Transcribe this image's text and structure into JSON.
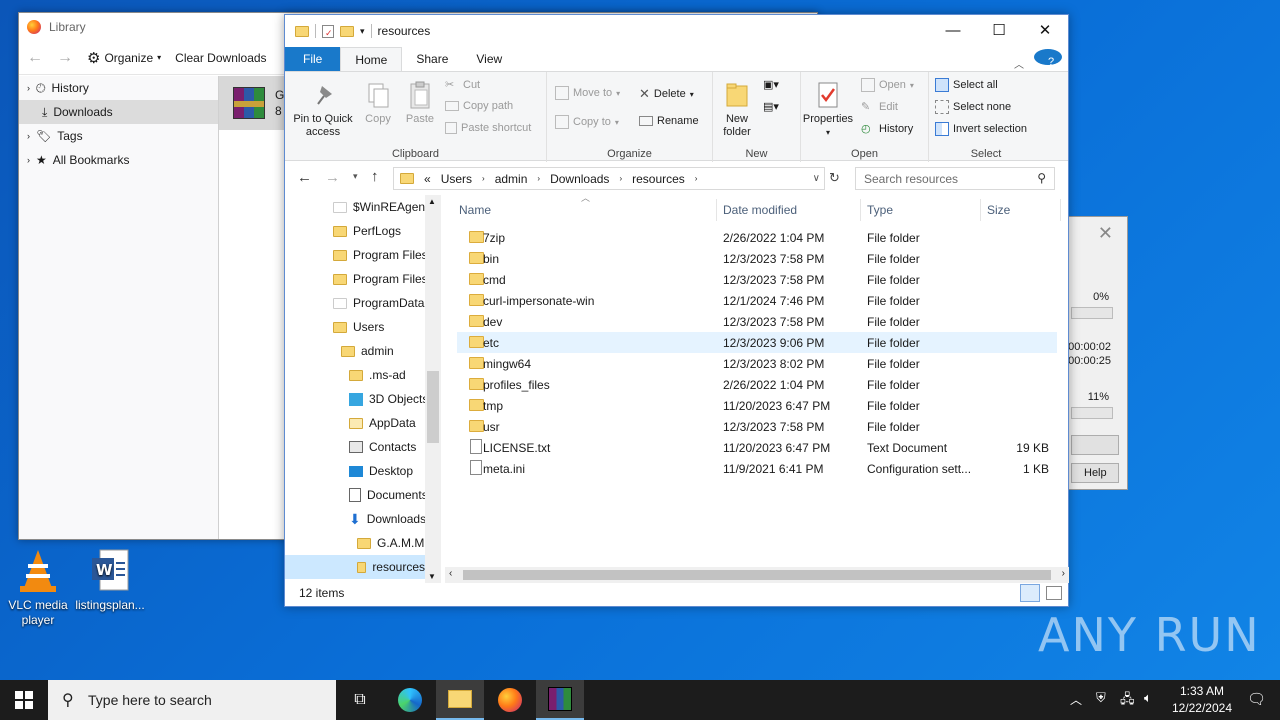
{
  "desktop": {
    "icons": [
      {
        "label": "VLC media player"
      },
      {
        "label": "listingsplan..."
      }
    ],
    "watermark": "ANY RUN"
  },
  "library": {
    "title": "Library",
    "organize_label": "Organize",
    "clear_downloads_label": "Clear Downloads",
    "sidebar": [
      {
        "label": "History"
      },
      {
        "label": "Downloads"
      },
      {
        "label": "Tags"
      },
      {
        "label": "All Bookmarks"
      }
    ],
    "download_item_prefix": "G",
    "download_item_sub": "8"
  },
  "dialog": {
    "pct1": "0%",
    "time1": "00:00:02",
    "time2": "00:00:25",
    "pct2": "11%",
    "help_label": "Help"
  },
  "explorer": {
    "title": "resources",
    "tabs": {
      "file": "File",
      "home": "Home",
      "share": "Share",
      "view": "View"
    },
    "ribbon": {
      "pin_quick_access": "Pin to Quick access",
      "copy": "Copy",
      "paste": "Paste",
      "cut": "Cut",
      "copy_path": "Copy path",
      "paste_shortcut": "Paste shortcut",
      "clipboard_group": "Clipboard",
      "move_to": "Move to",
      "copy_to": "Copy to",
      "delete": "Delete",
      "rename": "Rename",
      "organize_group": "Organize",
      "new_folder": "New folder",
      "new_group": "New",
      "properties": "Properties",
      "open": "Open",
      "edit": "Edit",
      "history": "History",
      "open_group": "Open",
      "select_all": "Select all",
      "select_none": "Select none",
      "invert_selection": "Invert selection",
      "select_group": "Select"
    },
    "breadcrumb": [
      "«",
      "Users",
      "admin",
      "Downloads",
      "resources"
    ],
    "search_placeholder": "Search resources",
    "nav_tree": [
      {
        "label": "$WinREAgent"
      },
      {
        "label": "PerfLogs"
      },
      {
        "label": "Program Files"
      },
      {
        "label": "Program Files"
      },
      {
        "label": "ProgramData"
      },
      {
        "label": "Users"
      },
      {
        "label": "admin"
      },
      {
        "label": ".ms-ad"
      },
      {
        "label": "3D Objects"
      },
      {
        "label": "AppData"
      },
      {
        "label": "Contacts"
      },
      {
        "label": "Desktop"
      },
      {
        "label": "Documents"
      },
      {
        "label": "Downloads"
      },
      {
        "label": "G.A.M.M"
      },
      {
        "label": "resources"
      }
    ],
    "columns": {
      "name": "Name",
      "date": "Date modified",
      "type": "Type",
      "size": "Size"
    },
    "files": [
      {
        "name": "7zip",
        "date": "2/26/2022 1:04 PM",
        "type": "File folder",
        "size": ""
      },
      {
        "name": "bin",
        "date": "12/3/2023 7:58 PM",
        "type": "File folder",
        "size": ""
      },
      {
        "name": "cmd",
        "date": "12/3/2023 7:58 PM",
        "type": "File folder",
        "size": ""
      },
      {
        "name": "curl-impersonate-win",
        "date": "12/1/2024 7:46 PM",
        "type": "File folder",
        "size": ""
      },
      {
        "name": "dev",
        "date": "12/3/2023 7:58 PM",
        "type": "File folder",
        "size": ""
      },
      {
        "name": "etc",
        "date": "12/3/2023 9:06 PM",
        "type": "File folder",
        "size": ""
      },
      {
        "name": "mingw64",
        "date": "12/3/2023 8:02 PM",
        "type": "File folder",
        "size": ""
      },
      {
        "name": "profiles_files",
        "date": "2/26/2022 1:04 PM",
        "type": "File folder",
        "size": ""
      },
      {
        "name": "tmp",
        "date": "11/20/2023 6:47 PM",
        "type": "File folder",
        "size": ""
      },
      {
        "name": "usr",
        "date": "12/3/2023 7:58 PM",
        "type": "File folder",
        "size": ""
      },
      {
        "name": "LICENSE.txt",
        "date": "11/20/2023 6:47 PM",
        "type": "Text Document",
        "size": "19 KB"
      },
      {
        "name": "meta.ini",
        "date": "11/9/2021 6:41 PM",
        "type": "Configuration sett...",
        "size": "1 KB"
      }
    ],
    "status": "12 items"
  },
  "taskbar": {
    "search_placeholder": "Type here to search",
    "time": "1:33 AM",
    "date": "12/22/2024"
  }
}
